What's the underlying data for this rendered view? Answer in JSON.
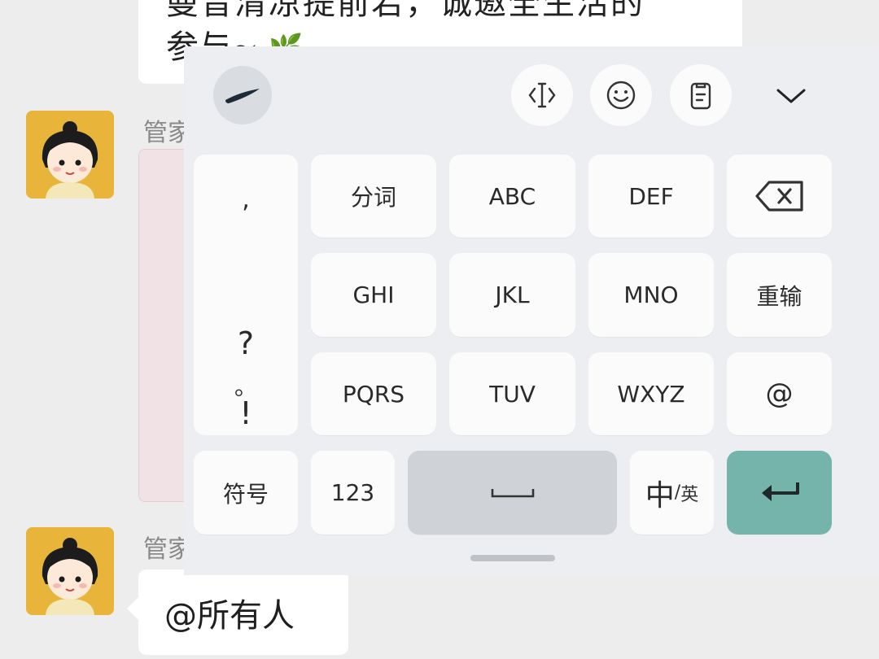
{
  "chat": {
    "top_message_line1": "曼音清凉提前若，诚邀全生活的",
    "top_message_line2": "参与~",
    "top_message_emoji": "🌿",
    "sender_1": "管家",
    "sender_2": "管家",
    "mention_message": "@所有人"
  },
  "keyboard": {
    "toolbar": {
      "logo_icon": "swoosh-logo-icon",
      "cursor_icon": "text-cursor-icon",
      "emoji_icon": "smiley-icon",
      "clipboard_icon": "clipboard-icon",
      "collapse_icon": "chevron-down-icon"
    },
    "punctuation": [
      ",",
      "。",
      "?",
      "!"
    ],
    "rows": [
      [
        "分词",
        "ABC",
        "DEF"
      ],
      [
        "GHI",
        "JKL",
        "MNO"
      ],
      [
        "PQRS",
        "TUV",
        "WXYZ"
      ]
    ],
    "right_column": {
      "delete_icon": "backspace-icon",
      "retype": "重输",
      "at": "@"
    },
    "bottom": {
      "symbols": "符号",
      "numbers": "123",
      "space_icon": "space-bar-icon",
      "lang_main": "中",
      "lang_sep": "/",
      "lang_alt": "英",
      "enter_icon": "enter-arrow-icon"
    },
    "accent_color": "#74b4aa"
  }
}
